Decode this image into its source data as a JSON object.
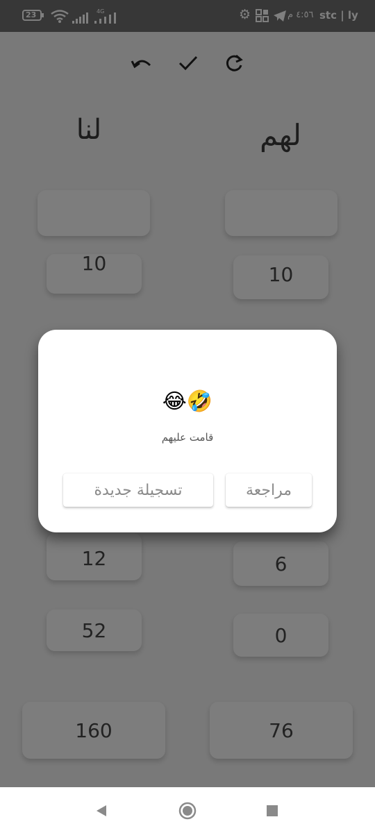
{
  "status_bar": {
    "carrier": "stc | ly",
    "time": "٤:٥٦ م",
    "battery": "23",
    "network": "4G",
    "icons": [
      "battery-icon",
      "wifi-icon",
      "signal-icon",
      "signal-icon",
      "settings-icon",
      "apps-icon",
      "telegram-icon"
    ]
  },
  "toolbar": {
    "undo_icon": "undo-icon",
    "confirm_icon": "check-icon",
    "refresh_icon": "refresh-icon"
  },
  "teams": {
    "right": "لهم",
    "left": "لنا"
  },
  "scores": {
    "left_column": [
      "",
      "10",
      "12",
      "52"
    ],
    "right_column": [
      "",
      "10",
      "6",
      "0"
    ]
  },
  "totals": {
    "left": "160",
    "right": "76"
  },
  "dialog": {
    "emojis": "😂🤣",
    "message": "قامت عليهم",
    "review_button": "مراجعة",
    "new_game_button": "تسجيلة جديدة"
  },
  "nav": {
    "back": "back-icon",
    "home": "home-icon",
    "recents": "recents-icon"
  }
}
